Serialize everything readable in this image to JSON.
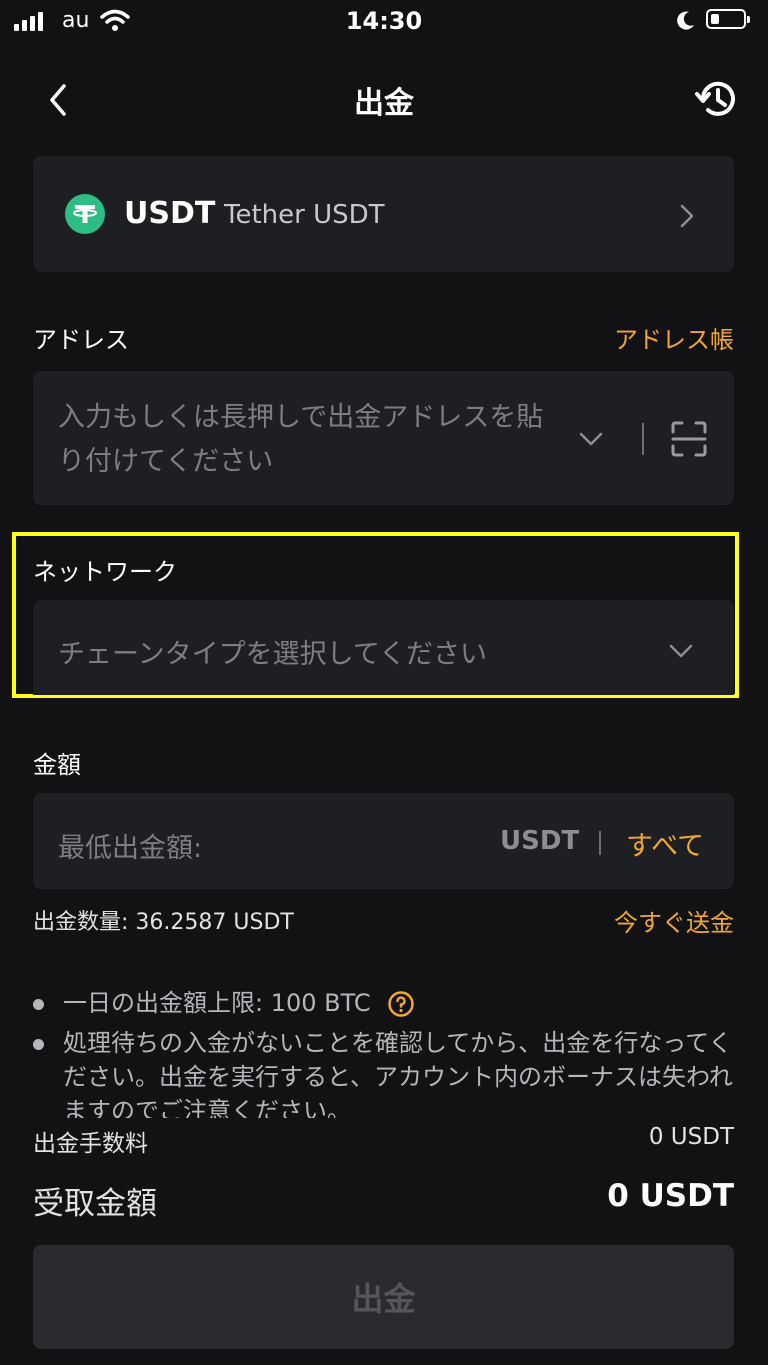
{
  "status_bar": {
    "carrier": "au",
    "time": "14:30"
  },
  "header": {
    "title": "出金"
  },
  "coin": {
    "symbol": "USDT",
    "name": "Tether USDT",
    "icon": "tether-icon",
    "icon_color": "#2ebd85"
  },
  "address": {
    "label": "アドレス",
    "book_link": "アドレス帳",
    "placeholder": "入力もしくは長押しで出金アドレスを貼り付けてください"
  },
  "network": {
    "label": "ネットワーク",
    "placeholder": "チェーンタイプを選択してください"
  },
  "amount": {
    "label": "金額",
    "placeholder": "最低出金額:",
    "unit": "USDT",
    "all_button": "すべて",
    "quantity": "出金数量: 36.2587 USDT",
    "send_now": "今すぐ送金"
  },
  "notes": [
    "一日の出金額上限: 100 BTC",
    "処理待ちの入金がないことを確認してから、出金を行なってください。出金を実行すると、アカウント内のボーナスは失われますのでご注意ください。"
  ],
  "fee": {
    "label": "出金手数料",
    "value": "0 USDT"
  },
  "receive": {
    "label": "受取金額",
    "value": "0 USDT"
  },
  "submit_label": "出金",
  "colors": {
    "accent": "#f0a733",
    "highlight": "#ffff1a",
    "background": "#121214",
    "card": "#1e1f22"
  }
}
